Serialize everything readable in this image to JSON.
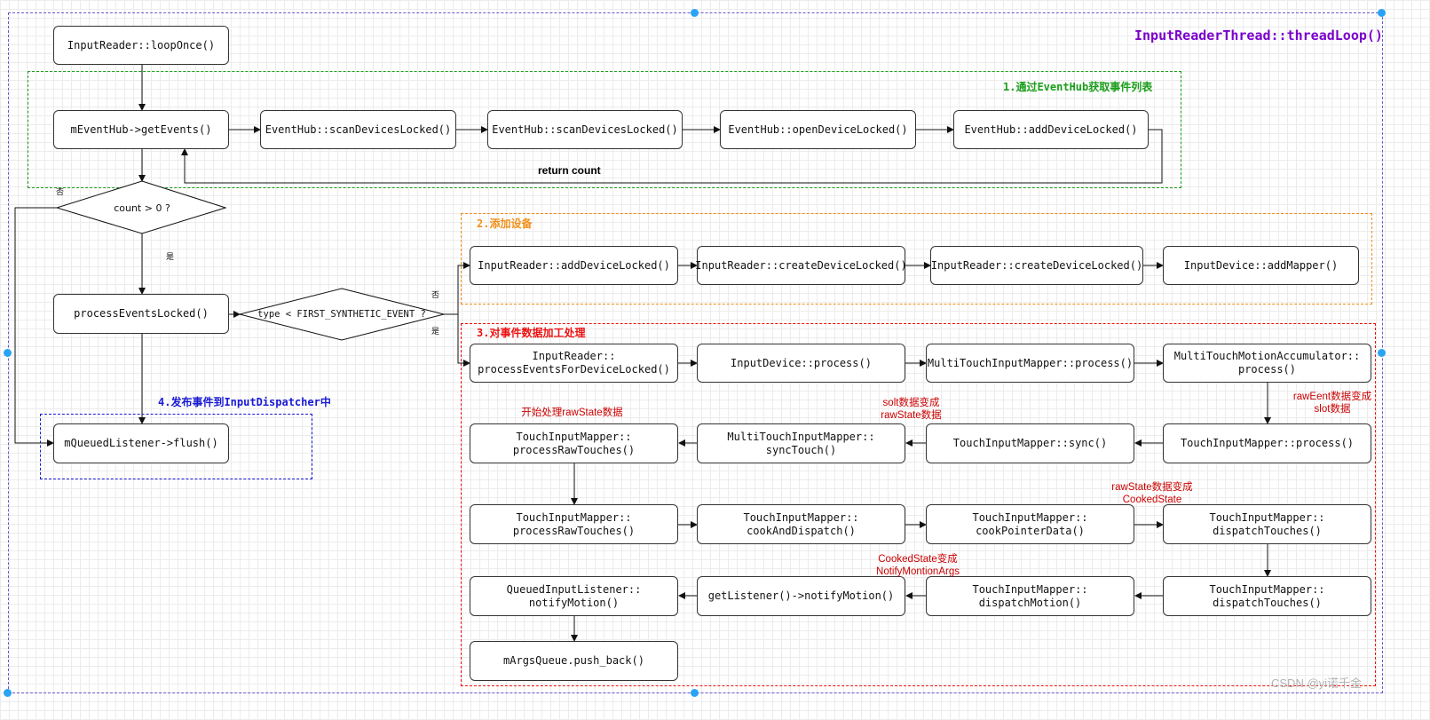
{
  "title": "InputReaderThread::threadLoop()",
  "groups": {
    "g1": "1.通过EventHub获取事件列表",
    "g2": "2.添加设备",
    "g3": "3.对事件数据加工处理",
    "g4": "4.发布事件到InputDispatcher中"
  },
  "nodes": {
    "loop_once": "InputReader::loopOnce()",
    "get_events": "mEventHub->getEvents()",
    "scan1": "EventHub::scanDevicesLocked()",
    "scan2": "EventHub::scanDevicesLocked()",
    "open_device": "EventHub::openDeviceLocked()",
    "add_device_hub": "EventHub::addDeviceLocked()",
    "process_events": "processEventsLocked()",
    "flush": "mQueuedListener->flush()",
    "reader_add_device": "InputReader::addDeviceLocked()",
    "create_device1": "InputReader::createDeviceLocked()",
    "create_device2": "InputReader::createDeviceLocked()",
    "add_mapper": "InputDevice::addMapper()",
    "process_for_device": "InputReader::\nprocessEventsForDeviceLocked()",
    "device_process": "InputDevice::process()",
    "mt_mapper_process": "MultiTouchInputMapper::process()",
    "mt_accum_process": "MultiTouchMotionAccumulator::\nprocess()",
    "raw_touches1": "TouchInputMapper::\nprocessRawTouches()",
    "sync_touch": "MultiTouchInputMapper::\nsyncTouch()",
    "touch_sync": "TouchInputMapper::sync()",
    "touch_process": "TouchInputMapper::process()",
    "raw_touches2": "TouchInputMapper::\nprocessRawTouches()",
    "cook_dispatch": "TouchInputMapper::\ncookAndDispatch()",
    "cook_pointer": "TouchInputMapper::\ncookPointerData()",
    "dispatch_touches1": "TouchInputMapper::\ndispatchTouches()",
    "notify_motion": "QueuedInputListener::\nnotifyMotion()",
    "get_listener": "getListener()->notifyMotion()",
    "dispatch_motion": "TouchInputMapper::\ndispatchMotion()",
    "dispatch_touches2": "TouchInputMapper::\ndispatchTouches()",
    "push_back": "mArgsQueue.push_back()"
  },
  "decisions": {
    "count": "count > 0 ?",
    "type": "type < FIRST_SYNTHETIC_EVENT ?"
  },
  "edge_labels": {
    "return_count": "return count",
    "count_no": "否",
    "count_yes": "是",
    "type_no": "否",
    "type_yes": "是"
  },
  "notes": {
    "start_raw": "开始处理rawState数据",
    "slot_change": "solt数据变成\nrawState数据",
    "raw_event_change": "rawEent数据变成\nslot数据",
    "raw_to_cooked": "rawState数据变成\nCookedState",
    "cooked_to_notify": "CookedState变成\nNotifyMontionArgs"
  },
  "watermark": "CSDN @yi诺千金",
  "colors": {
    "title": "#7a00cc",
    "group1": "#1a9e1a",
    "group2": "#f0901a",
    "group3": "#ee1111",
    "group4": "#1a1ad6",
    "note": "#cc0000",
    "handle": "#29a3f5"
  }
}
